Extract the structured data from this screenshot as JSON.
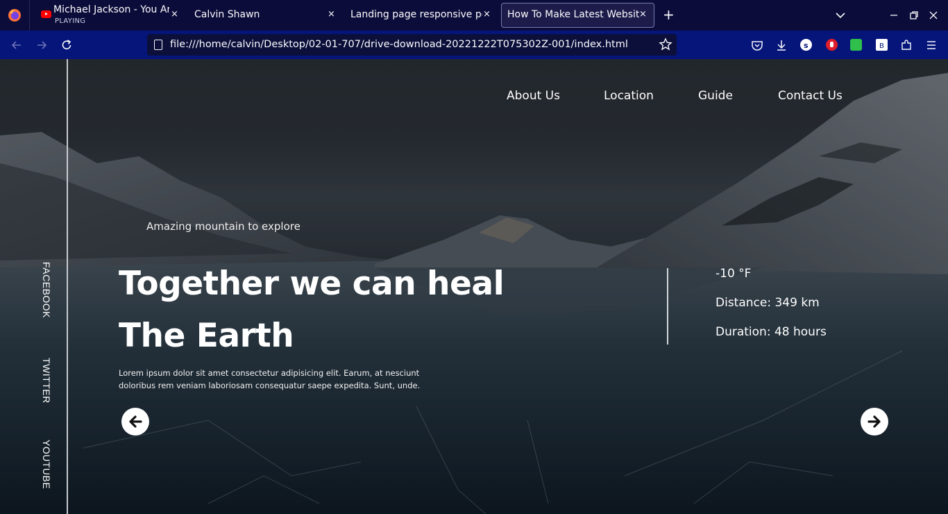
{
  "browser": {
    "tabs": [
      {
        "title": "Michael Jackson - You Are Not Alone",
        "subtitle": "PLAYING",
        "icon": "youtube-icon"
      },
      {
        "title": "Calvin Shawn"
      },
      {
        "title": "Landing page responsive portfolio"
      },
      {
        "title": "How To Make Latest Website",
        "active": true
      }
    ],
    "close_glyph": "×",
    "new_tab_glyph": "+",
    "url": "file:///home/calvin/Desktop/02-01-707/drive-download-20221222T075302Z-001/index.html"
  },
  "page": {
    "menu": [
      "About Us",
      "Location",
      "Guide",
      "Contact Us"
    ],
    "social": [
      "FACEBOOK",
      "TWITTER",
      "YOUTUBE"
    ],
    "kicker": "Amazing mountain to explore",
    "headline_line1": "Together we can heal",
    "headline_line2": "The Earth",
    "description": "Lorem ipsum dolor sit amet consectetur adipisicing elit. Earum, at nesciunt doloribus rem veniam laboriosam consequatur saepe expedita. Sunt, unde.",
    "temperature": "-10 °F",
    "distance": "Distance: 349 km",
    "duration": "Duration: 48 hours"
  },
  "colors": {
    "tabstrip": "#0c0c3a",
    "navbar": "#05157a",
    "urlbar": "#0b0f3a"
  }
}
